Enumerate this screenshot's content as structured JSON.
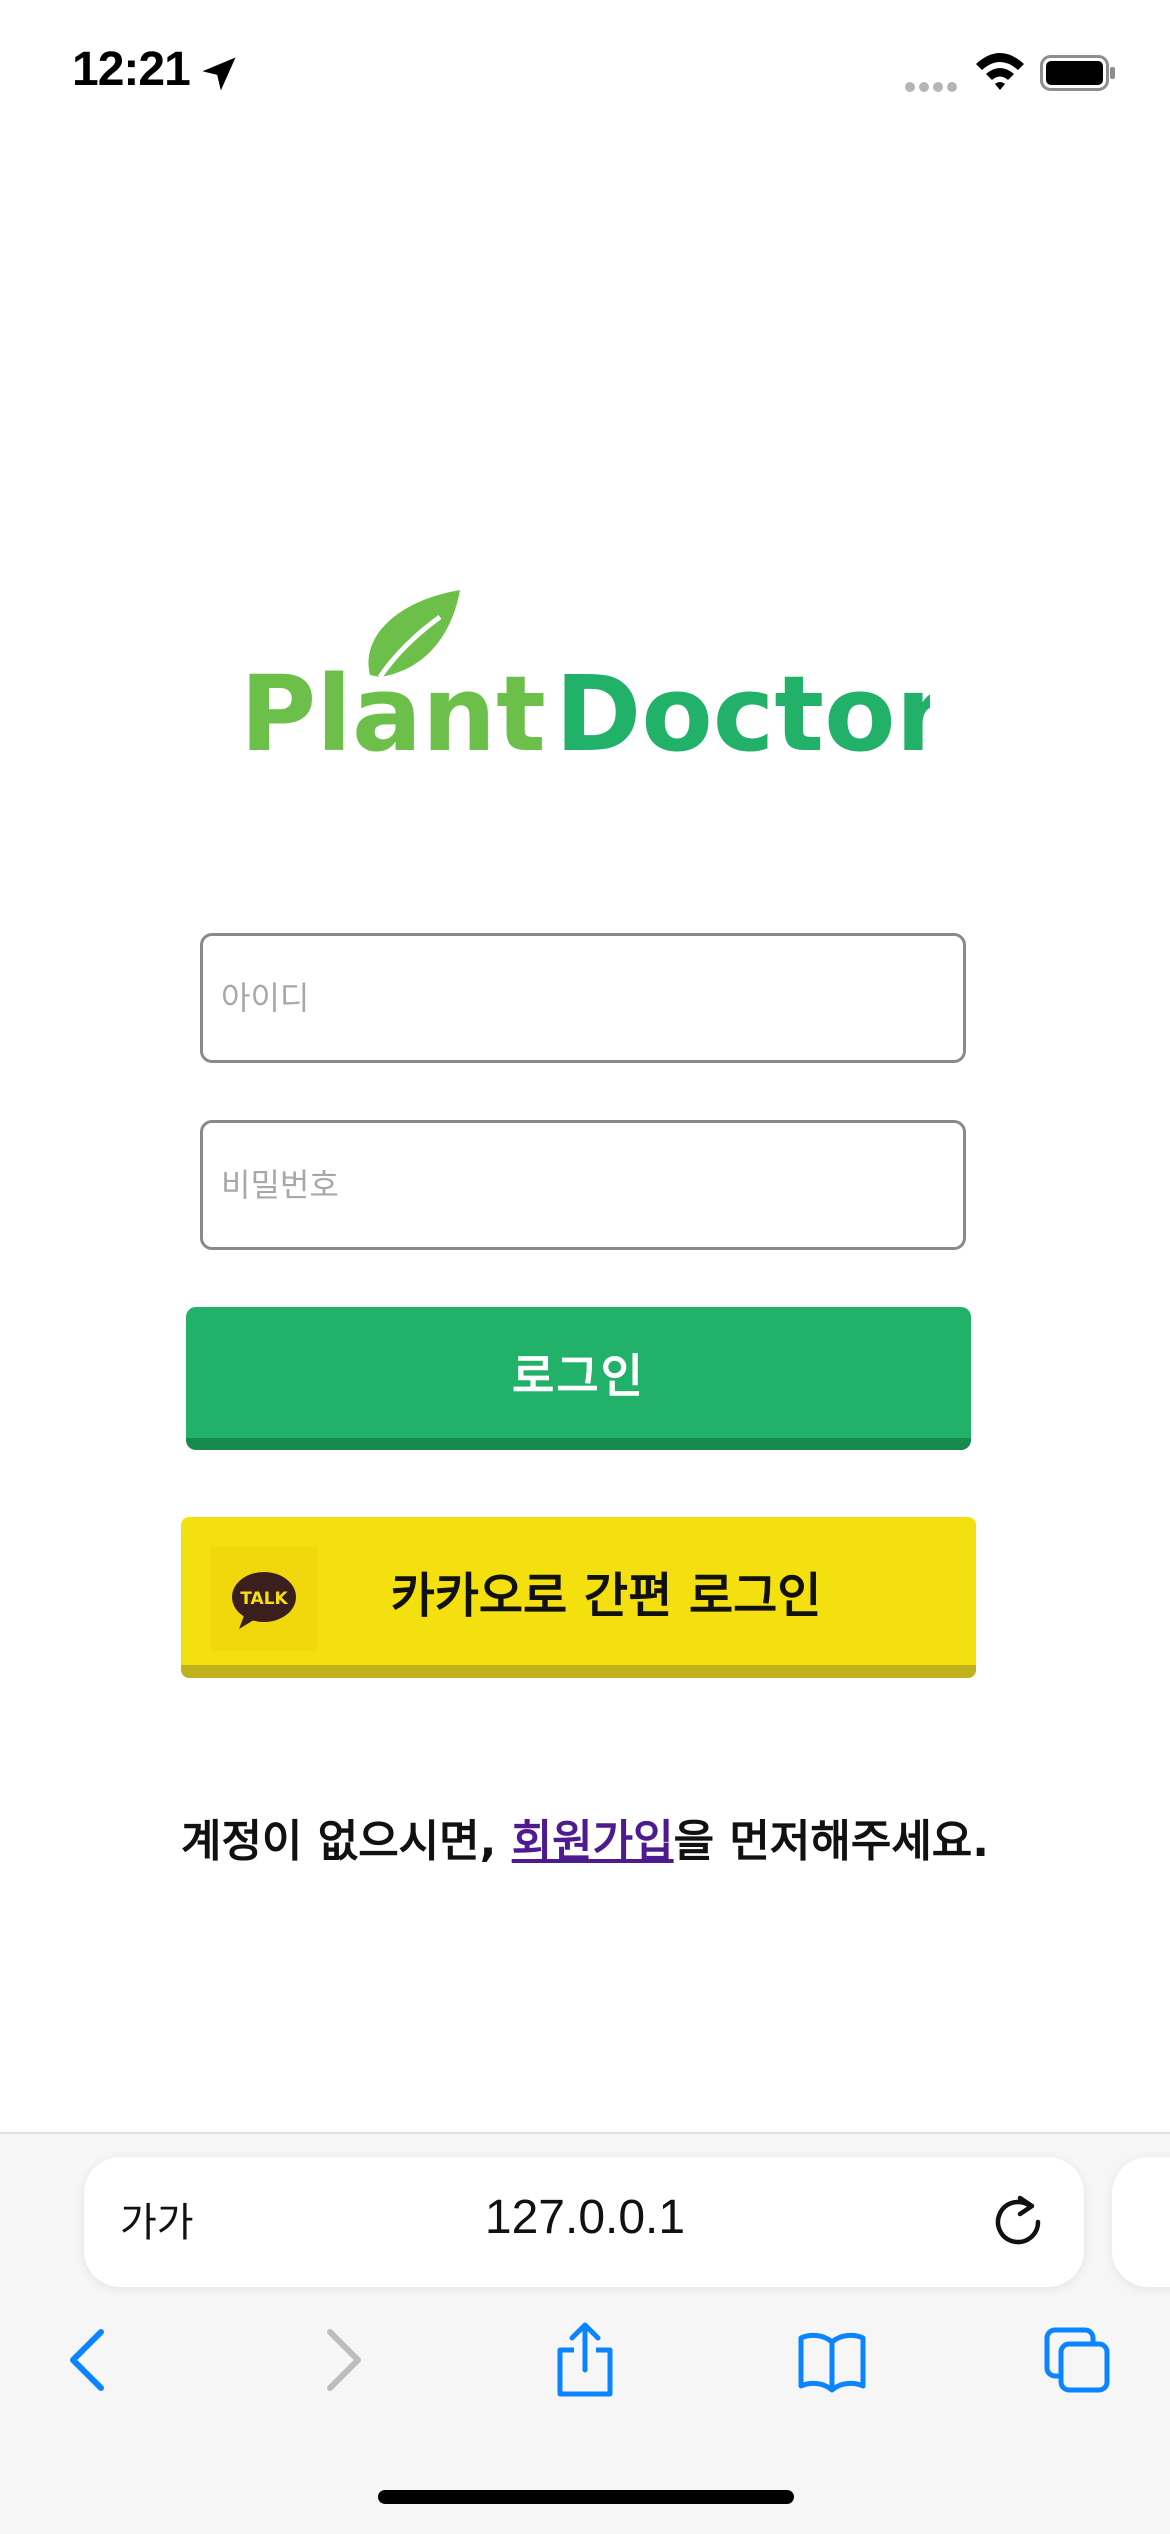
{
  "status_bar": {
    "time": "12:21"
  },
  "logo": {
    "text_plant": "Plant",
    "text_doctor": "Doctor",
    "colors": {
      "plant": "#6cc04a",
      "doctor": "#22b168"
    }
  },
  "login_form": {
    "id_placeholder": "아이디",
    "password_placeholder": "비밀번호",
    "login_label": "로그인",
    "kakao_label": "카카오로 간편 로그인",
    "kakao_badge": "TALK"
  },
  "signup": {
    "prefix": "계정이 없으시면, ",
    "link": "회원가입",
    "suffix": "을 먼저해주세요."
  },
  "browser": {
    "text_size_label": "가가",
    "url": "127.0.0.1"
  }
}
